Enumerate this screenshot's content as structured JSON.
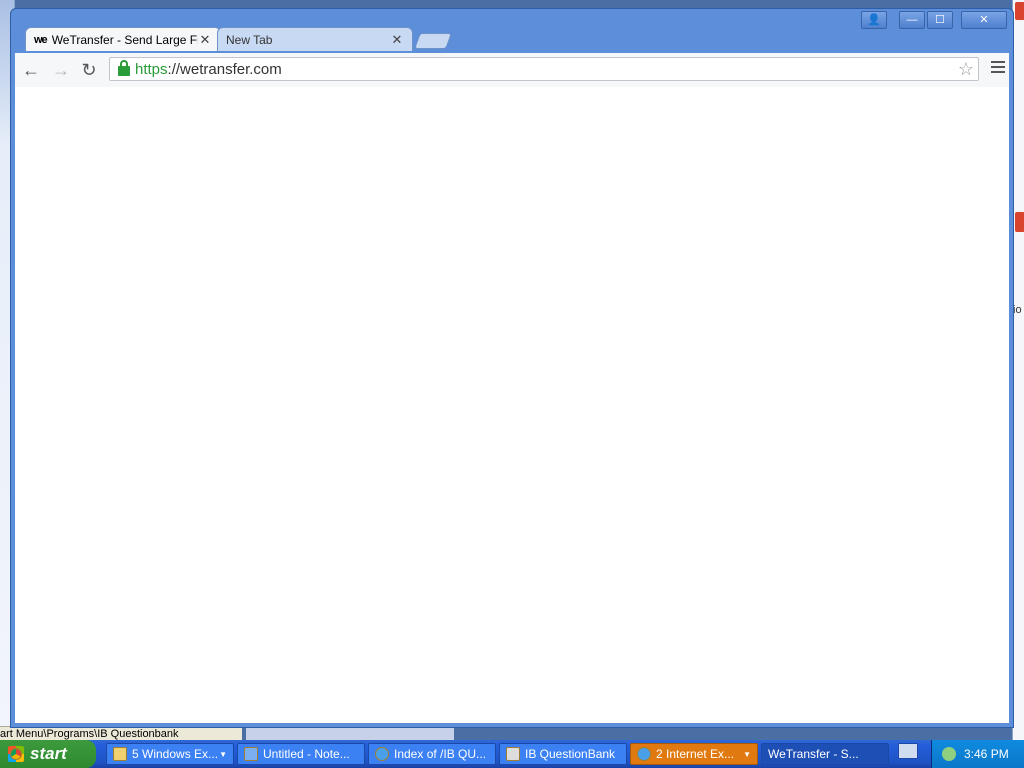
{
  "browser": {
    "tabs": [
      {
        "favicon": "we",
        "title": "WeTransfer - Send Large Files",
        "active": true
      },
      {
        "title": "New Tab",
        "active": false
      }
    ],
    "address": {
      "scheme": "https",
      "separator": "://",
      "host": "wetransfer.com"
    },
    "icons": {
      "back": "←",
      "forward": "→",
      "reload": "↻",
      "star": "☆",
      "close": "✕",
      "minimize": "—",
      "maximize": "☐",
      "user": "👤"
    }
  },
  "background": {
    "status_text": "art Menu\\Programs\\IB Questionbank",
    "right_text": "io"
  },
  "taskbar": {
    "start_label": "start",
    "items": [
      {
        "label": "5 Windows Ex...",
        "icon": "folder-icon"
      },
      {
        "label": "Untitled - Note...",
        "icon": "notepad-icon"
      },
      {
        "label": "Index of /IB QU...",
        "icon": "ie-icon"
      },
      {
        "label": "IB QuestionBank",
        "icon": "questionbank-icon"
      },
      {
        "label": "2 Internet Ex...",
        "icon": "ie-icon"
      },
      {
        "label": "WeTransfer - S...",
        "icon": "chrome-icon"
      }
    ],
    "clock": "3:46 PM"
  }
}
